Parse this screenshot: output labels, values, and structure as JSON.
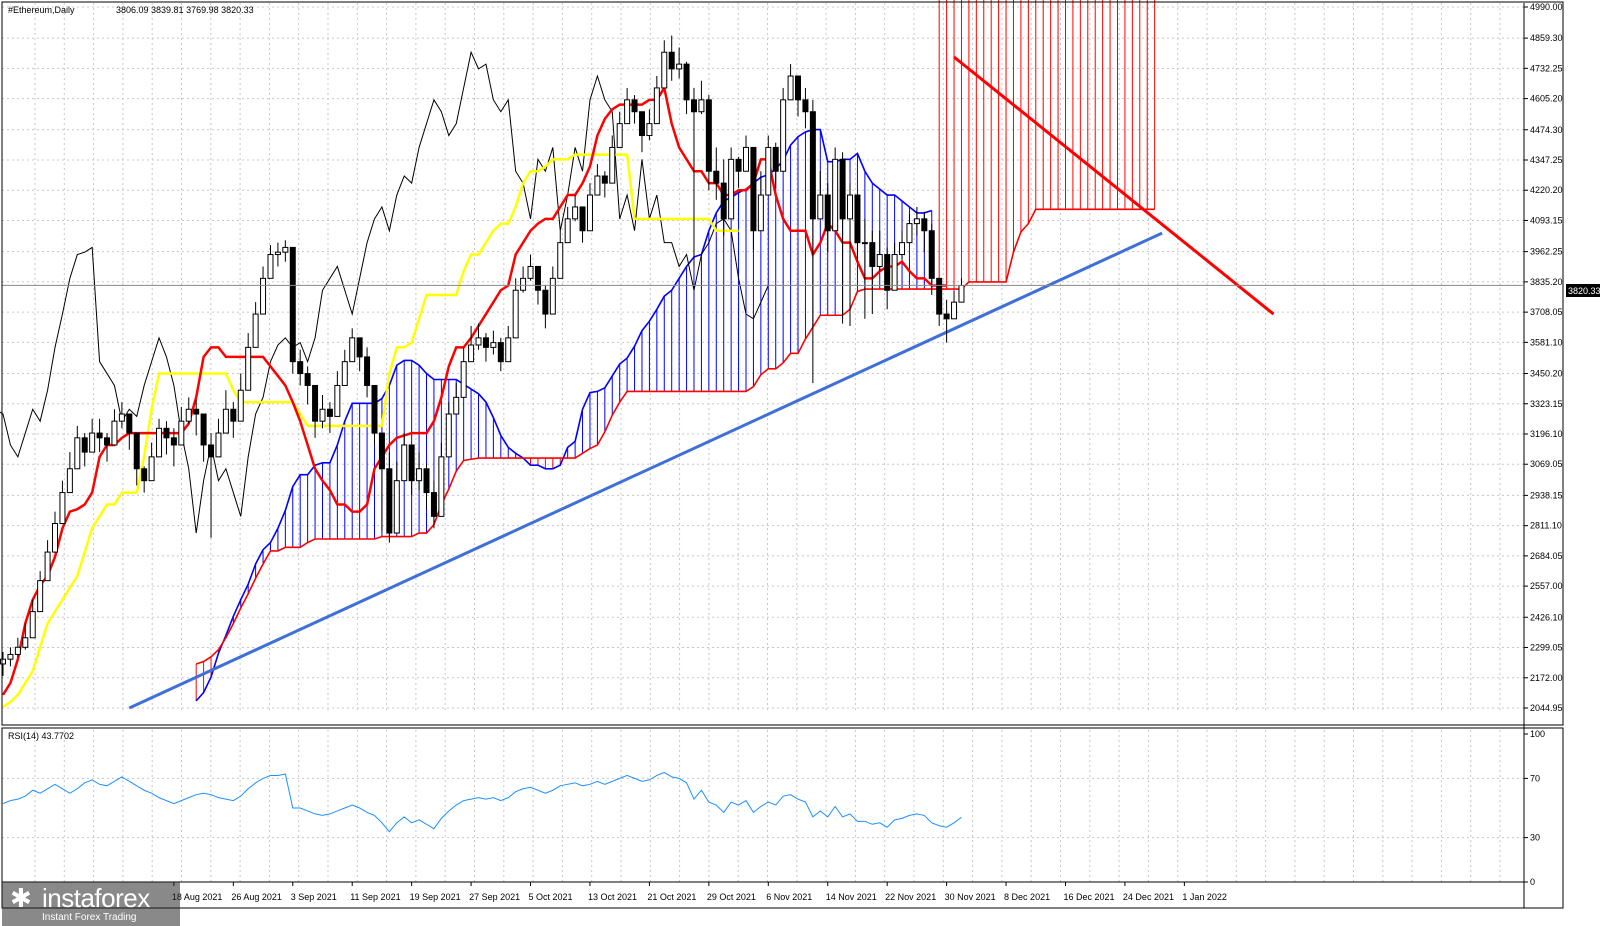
{
  "header": {
    "symbol": "#Ethereum,Daily",
    "ohlc": "3806.09 3839.81 3769.98 3820.33"
  },
  "rsi_header": "RSI(14) 43.7702",
  "price_tag": "3820.33",
  "watermark": {
    "name": "instaforex",
    "tagline": "Instant Forex Trading"
  },
  "colors": {
    "tenkan": "#ff0000",
    "kijun": "#ffff00",
    "chikou": "#000000",
    "kumo_bull": "#0000ff",
    "kumo_bear": "#ff0000",
    "trendline_up": "#3f6fd8",
    "trendline_down": "#ff0000",
    "rsi": "#1e90ff",
    "grid": "#c8c8c8"
  },
  "chart_data": [
    {
      "type": "candlestick",
      "title": "#Ethereum,Daily",
      "ylim": [
        2044.95,
        4990.0
      ],
      "y_ticks": [
        "4990.00",
        "4859.30",
        "4732.25",
        "4605.20",
        "4474.30",
        "4347.25",
        "4220.20",
        "4093.15",
        "3962.25",
        "3835.20",
        "3708.05",
        "3581.10",
        "3450.20",
        "3323.15",
        "3196.10",
        "3069.05",
        "2938.15",
        "2811.10",
        "2684.05",
        "2557.00",
        "2426.10",
        "2299.05",
        "2172.00",
        "2044.95"
      ],
      "x_ticks": [
        "18 Aug 2021",
        "26 Aug 2021",
        "3 Sep 2021",
        "11 Sep 2021",
        "19 Sep 2021",
        "27 Sep 2021",
        "5 Oct 2021",
        "13 Oct 2021",
        "21 Oct 2021",
        "29 Oct 2021",
        "6 Nov 2021",
        "14 Nov 2021",
        "22 Nov 2021",
        "30 Nov 2021",
        "8 Dec 2021",
        "16 Dec 2021",
        "24 Dec 2021",
        "1 Jan 2022"
      ],
      "x_start": "2021-07-26",
      "last_price": 3820.33,
      "closes": [
        2250,
        2270,
        2300,
        2340,
        2450,
        2580,
        2700,
        2820,
        2950,
        3050,
        3180,
        3120,
        3200,
        3180,
        3150,
        3250,
        3280,
        3200,
        3050,
        3000,
        3100,
        3220,
        3180,
        3150,
        3250,
        3300,
        3280,
        3150,
        3100,
        3200,
        3300,
        3250,
        3380,
        3560,
        3700,
        3850,
        3950,
        3960,
        3980,
        3500,
        3450,
        3400,
        3250,
        3300,
        3270,
        3400,
        3500,
        3600,
        3520,
        3400,
        3200,
        3050,
        2780,
        3000,
        3150,
        3000,
        3050,
        2950,
        2850,
        3100,
        3280,
        3350,
        3500,
        3570,
        3600,
        3560,
        3580,
        3500,
        3600,
        3800,
        3850,
        3900,
        3800,
        3700,
        3850,
        4000,
        4100,
        4150,
        4050,
        4200,
        4280,
        4250,
        4400,
        4500,
        4600,
        4550,
        4450,
        4500,
        4650,
        4800,
        4730,
        4750,
        4600,
        4550,
        4600,
        4300,
        4250,
        4100,
        4350,
        4300,
        4400,
        4050,
        4200,
        4400,
        4300,
        4600,
        4700,
        4600,
        4550,
        4100,
        4200,
        4050,
        4350,
        4100,
        4200,
        4000,
        4000,
        3900,
        3950,
        3800,
        3950,
        4000,
        4080,
        4100,
        4050,
        3850,
        3700,
        3680,
        3750,
        3820
      ],
      "high": [
        2280,
        2300,
        2340,
        2400,
        2500,
        2620,
        2750,
        2870,
        3000,
        3120,
        3230,
        3200,
        3260,
        3260,
        3200,
        3300,
        3330,
        3260,
        3150,
        3060,
        3160,
        3260,
        3250,
        3220,
        3310,
        3350,
        3340,
        3250,
        3200,
        3260,
        3380,
        3330,
        3450,
        3620,
        3750,
        3900,
        3990,
        4000,
        4010,
        3980,
        3550,
        3480,
        3380,
        3360,
        3330,
        3460,
        3550,
        3640,
        3590,
        3560,
        3300,
        3160,
        3120,
        3080,
        3200,
        3100,
        3120,
        3070,
        3000,
        3160,
        3330,
        3410,
        3560,
        3650,
        3660,
        3620,
        3630,
        3600,
        3650,
        3850,
        3900,
        3950,
        3890,
        3820,
        3900,
        4050,
        4150,
        4200,
        4150,
        4250,
        4330,
        4300,
        4450,
        4550,
        4650,
        4620,
        4550,
        4560,
        4700,
        4850,
        4870,
        4820,
        4760,
        4650,
        4680,
        4620,
        4400,
        4350,
        4400,
        4360,
        4450,
        4400,
        4300,
        4450,
        4420,
        4650,
        4750,
        4700,
        4650,
        4600,
        4300,
        4250,
        4400,
        4380,
        4250,
        4150,
        4100,
        4050,
        4050,
        3980,
        4000,
        4050,
        4120,
        4150,
        4130,
        4080,
        3800,
        3760,
        3800,
        3850
      ],
      "low": [
        2180,
        2220,
        2260,
        2290,
        2400,
        2540,
        2650,
        2780,
        2900,
        2980,
        3080,
        3060,
        3130,
        3120,
        3080,
        3170,
        3220,
        3130,
        2980,
        2950,
        3030,
        3150,
        3110,
        3060,
        3180,
        3240,
        3190,
        3080,
        2760,
        3120,
        3240,
        3180,
        3300,
        3500,
        3640,
        3790,
        3880,
        3900,
        3920,
        3450,
        3400,
        3320,
        3180,
        3220,
        3200,
        3330,
        3450,
        3540,
        3460,
        3350,
        3150,
        2790,
        2740,
        2940,
        3080,
        2940,
        2960,
        2880,
        2800,
        3050,
        3220,
        3290,
        3440,
        3520,
        3550,
        3500,
        3530,
        3460,
        3540,
        3740,
        3790,
        3840,
        3740,
        3640,
        3800,
        3940,
        4040,
        4090,
        4000,
        4140,
        4220,
        4190,
        4340,
        4440,
        4540,
        4500,
        4380,
        4430,
        4580,
        4720,
        4680,
        4690,
        4540,
        3900,
        4540,
        4220,
        4180,
        4030,
        4270,
        4230,
        4330,
        3970,
        4120,
        4320,
        4230,
        4530,
        4630,
        4530,
        4480,
        3410,
        4140,
        3960,
        4290,
        3660,
        3650,
        3920,
        3680,
        3700,
        3880,
        3720,
        3880,
        3930,
        4000,
        4030,
        3960,
        3780,
        3650,
        3580,
        3690,
        3760
      ],
      "tenkan": [
        2100,
        2150,
        2250,
        2400,
        2500,
        2560,
        2600,
        2680,
        2800,
        2870,
        2880,
        2900,
        2950,
        3100,
        3150,
        3150,
        3180,
        3200,
        3200,
        3200,
        3200,
        3200,
        3200,
        3200,
        3200,
        3240,
        3350,
        3520,
        3560,
        3560,
        3520,
        3520,
        3520,
        3520,
        3520,
        3520,
        3480,
        3440,
        3400,
        3330,
        3250,
        3150,
        3050,
        3000,
        2960,
        2900,
        2900,
        2870,
        2870,
        2900,
        3050,
        3100,
        3150,
        3180,
        3190,
        3200,
        3200,
        3200,
        3250,
        3350,
        3480,
        3560,
        3560,
        3600,
        3650,
        3700,
        3750,
        3800,
        3820,
        3950,
        4000,
        4050,
        4080,
        4100,
        4100,
        4150,
        4200,
        4200,
        4250,
        4320,
        4450,
        4520,
        4560,
        4580,
        4580,
        4580,
        4580,
        4600,
        4600,
        4650,
        4500,
        4400,
        4350,
        4300,
        4300,
        4250,
        4250,
        4200,
        4200,
        4220,
        4220,
        4250,
        4350,
        4350,
        4200,
        4100,
        4050,
        4050,
        4050,
        3950,
        4000,
        4080,
        4050,
        4000,
        4000,
        3920,
        3850,
        3850,
        3880,
        3900,
        3900,
        3920,
        3880,
        3850,
        3850,
        3820,
        3820,
        3820
      ],
      "kijun": [
        2050,
        2070,
        2100,
        2150,
        2200,
        2300,
        2400,
        2450,
        2500,
        2550,
        2600,
        2700,
        2800,
        2850,
        2900,
        2900,
        2950,
        2950,
        2950,
        3100,
        3300,
        3450,
        3450,
        3450,
        3450,
        3450,
        3450,
        3450,
        3450,
        3450,
        3450,
        3380,
        3330,
        3330,
        3330,
        3330,
        3330,
        3330,
        3330,
        3330,
        3280,
        3230,
        3230,
        3230,
        3230,
        3230,
        3230,
        3230,
        3230,
        3230,
        3230,
        3230,
        3450,
        3560,
        3560,
        3580,
        3680,
        3780,
        3780,
        3780,
        3780,
        3780,
        3880,
        3950,
        3950,
        4000,
        4050,
        4080,
        4080,
        4150,
        4250,
        4300,
        4300,
        4320,
        4350,
        4350,
        4350,
        4370,
        4370,
        4370,
        4370,
        4370,
        4370,
        4370,
        4370,
        4100,
        4100,
        4100,
        4100,
        4100,
        4100,
        4100,
        4100,
        4100,
        4100,
        4100,
        4050,
        4050,
        4050,
        4050
      ],
      "rsi": {
        "ylim": [
          0,
          100
        ],
        "y_ticks": [
          "100",
          "70",
          "30",
          "0"
        ],
        "last": 43.7702,
        "values": [
          53,
          55,
          56,
          58,
          62,
          60,
          63,
          66,
          63,
          60,
          63,
          67,
          69,
          66,
          65,
          68,
          71,
          68,
          65,
          62,
          60,
          57,
          55,
          53,
          55,
          57,
          59,
          60,
          59,
          57,
          56,
          55,
          58,
          63,
          67,
          70,
          72,
          72,
          73,
          50,
          50,
          48,
          46,
          45,
          46,
          48,
          50,
          52,
          50,
          47,
          45,
          40,
          34,
          40,
          44,
          40,
          42,
          39,
          36,
          43,
          48,
          52,
          55,
          56,
          57,
          56,
          57,
          55,
          57,
          61,
          63,
          64,
          62,
          60,
          62,
          65,
          66,
          67,
          65,
          66,
          68,
          66,
          68,
          70,
          72,
          70,
          68,
          69,
          72,
          74,
          71,
          70,
          67,
          56,
          62,
          54,
          52,
          47,
          54,
          52,
          55,
          47,
          51,
          54,
          52,
          58,
          59,
          56,
          54,
          44,
          48,
          44,
          51,
          44,
          46,
          41,
          41,
          39,
          40,
          37,
          42,
          43,
          45,
          46,
          45,
          40,
          38,
          37,
          40,
          43.77
        ]
      }
    }
  ]
}
